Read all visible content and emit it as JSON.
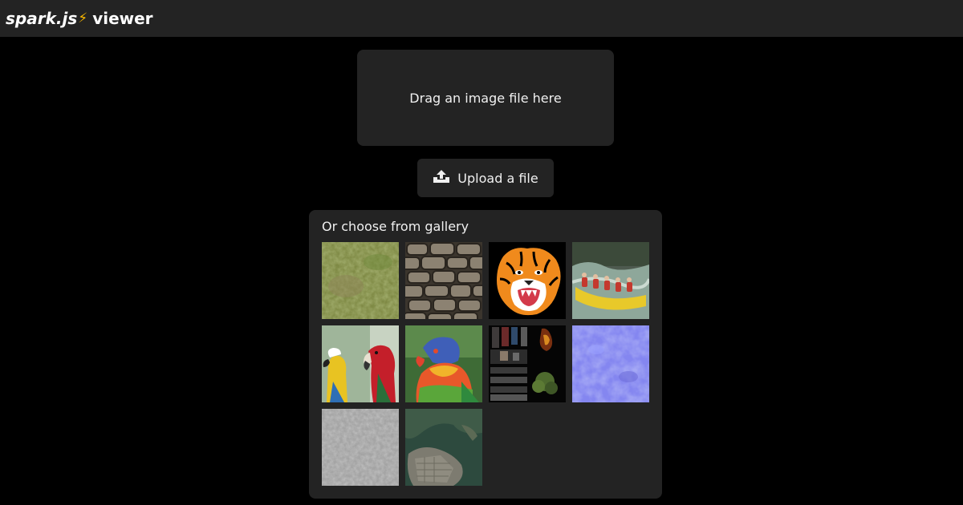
{
  "header": {
    "brand_name": "spark.js",
    "brand_icon": "lightning-icon",
    "brand_suffix": "viewer"
  },
  "dropzone": {
    "label": "Drag an image file here"
  },
  "upload": {
    "label": "Upload a file",
    "icon": "upload-icon"
  },
  "gallery": {
    "title": "Or choose from gallery",
    "items": [
      {
        "name": "grass-texture"
      },
      {
        "name": "stone-wall-texture"
      },
      {
        "name": "tiger"
      },
      {
        "name": "river-rafting"
      },
      {
        "name": "macaws"
      },
      {
        "name": "lorikeet"
      },
      {
        "name": "texture-atlas"
      },
      {
        "name": "normal-map"
      },
      {
        "name": "gray-noise-texture"
      },
      {
        "name": "aerial-city-map"
      }
    ]
  },
  "colors": {
    "background": "#000000",
    "panel": "#232323",
    "accent_bolt": "#f5b400"
  }
}
